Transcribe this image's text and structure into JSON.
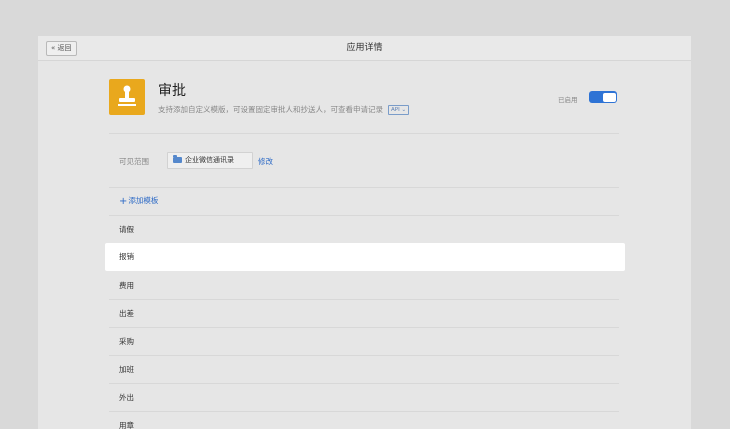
{
  "header": {
    "back_label": "« 返回",
    "title": "应用详情"
  },
  "app": {
    "name": "审批",
    "description": "支持添加自定义模版，可设置固定审批人和抄送人，可查看申请记录",
    "api_badge": "API ⌄",
    "icon": "stamp-icon",
    "icon_color": "#e9a81d",
    "status_label": "已启用",
    "enabled": true,
    "toggle_color": "#2e73d5"
  },
  "visibility": {
    "label": "可见范围",
    "value": "企业微信通讯录",
    "value_icon": "folder-icon",
    "modify_label": "修改"
  },
  "templates": {
    "add_label": "添加模板",
    "items": [
      "请假",
      "报销",
      "费用",
      "出差",
      "采购",
      "加班",
      "外出",
      "用章"
    ],
    "selected": "报销"
  }
}
